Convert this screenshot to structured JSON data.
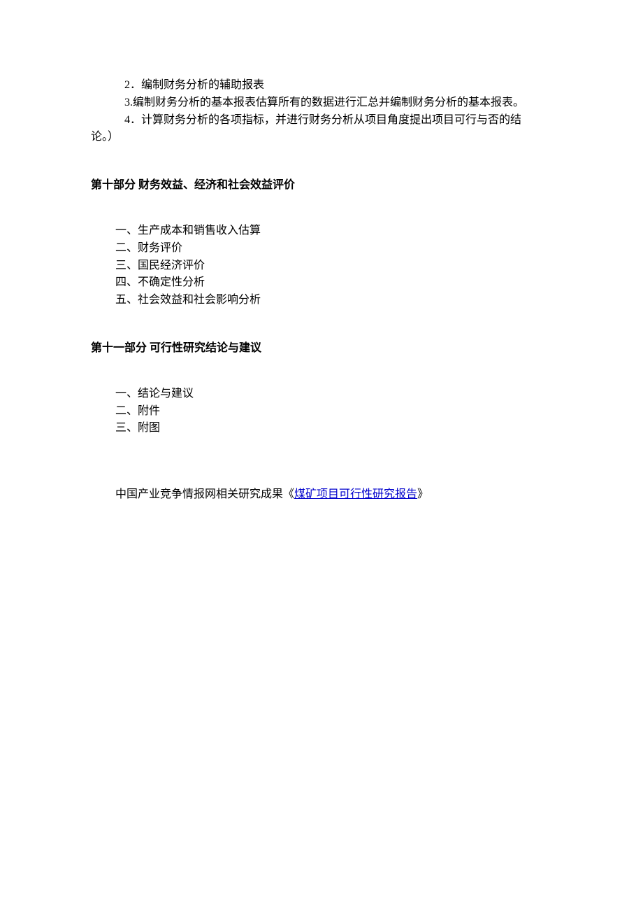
{
  "topBlock": {
    "l2": "2．编制财务分析的辅助报表",
    "l3": "3.编制财务分析的基本报表估算所有的数据进行汇总并编制财务分析的基本报表。",
    "l4a": "4．计算财务分析的各项指标，并进行财务分析从项目角度提出项目可行与否的结",
    "l4b": "论。）"
  },
  "section10": {
    "heading": "第十部分 财务效益、经济和社会效益评价",
    "items": [
      "一、生产成本和销售收入估算",
      "二、财务评价",
      "三、国民经济评价",
      "四、不确定性分析",
      "五、社会效益和社会影响分析"
    ]
  },
  "section11": {
    "heading": "第十一部分 可行性研究结论与建议",
    "items": [
      "一、结论与建议",
      "二、附件",
      "三、附图"
    ]
  },
  "reference": {
    "prefix": "中国产业竞争情报网相关研究成果《",
    "linkText": "煤矿项目可行性研究报告",
    "suffix": "》"
  }
}
